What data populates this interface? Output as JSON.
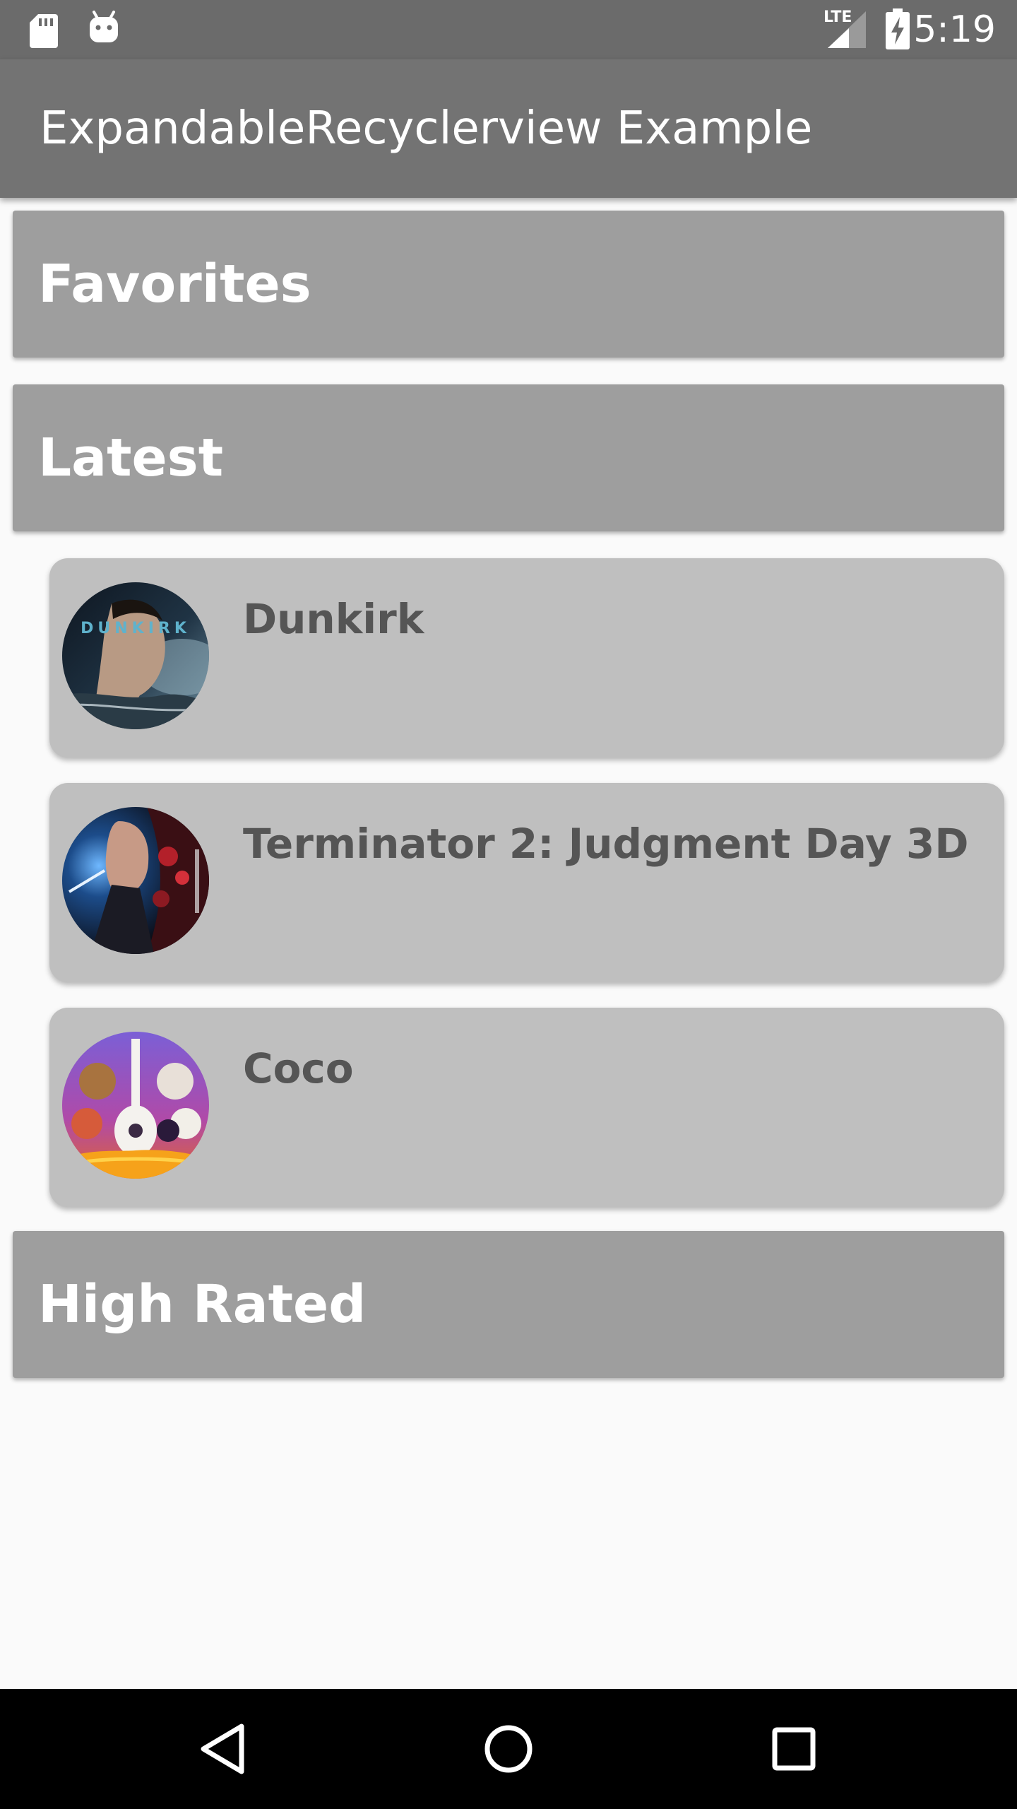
{
  "status_bar": {
    "time": "5:19",
    "network_label": "LTE",
    "icons": [
      "sd-card-icon",
      "android-icon",
      "lte-signal-icon",
      "battery-charging-icon"
    ]
  },
  "app_bar": {
    "title": "ExpandableRecyclerview Example"
  },
  "groups": [
    {
      "title": "Favorites",
      "expanded": false
    },
    {
      "title": "Latest",
      "expanded": true,
      "items": [
        {
          "title": "Dunkirk",
          "poster": "dunkirk-poster"
        },
        {
          "title": "Terminator 2: Judgment Day 3D",
          "poster": "terminator-poster"
        },
        {
          "title": "Coco",
          "poster": "coco-poster"
        }
      ]
    },
    {
      "title": "High Rated",
      "expanded": false
    }
  ],
  "nav_bar": {
    "buttons": [
      "back-icon",
      "home-icon",
      "recents-icon"
    ]
  },
  "colors": {
    "status_bar": "#6b6b6b",
    "app_bar": "#737373",
    "group_header": "#9e9e9e",
    "child_card": "#bfbfbf",
    "child_text": "#555555",
    "background": "#fafafa",
    "nav_bar": "#000000"
  }
}
